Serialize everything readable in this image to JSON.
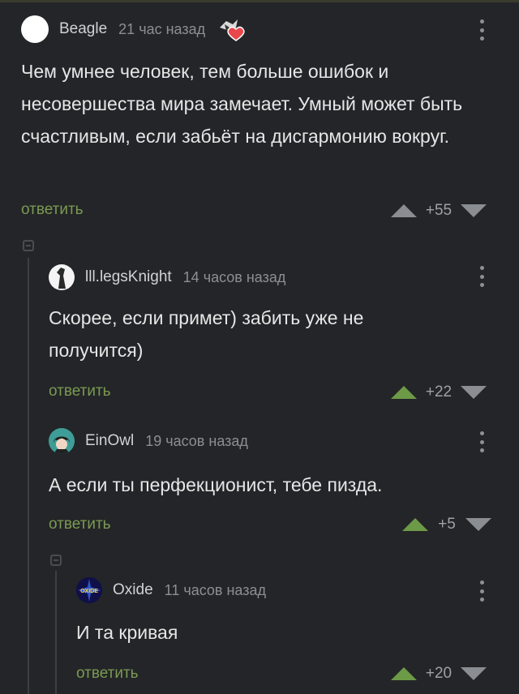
{
  "comments": [
    {
      "author": "Beagle",
      "time": "21 час назад",
      "text": "Чем умнее человек, тем больше ошибок и несовершества мира замечает. Умный может быть счастливым, если забьёт на дисгармонию вокруг.",
      "reply_label": "ответить",
      "score": "+55",
      "badge_icon": "heart-award-icon"
    },
    {
      "author": "lll.legsKnight",
      "time": "14 часов назад",
      "text": "Скорее, если примет) забить уже не получится)",
      "reply_label": "ответить",
      "score": "+22"
    },
    {
      "author": "EinOwl",
      "time": "19 часов назад",
      "text": "А если ты перфекционист, тебе пизда.",
      "reply_label": "ответить",
      "score": "+5"
    },
    {
      "author": "Oxide",
      "time": "11 часов назад",
      "text": "И та кривая",
      "reply_label": "ответить",
      "score": "+20",
      "avatar_text": "OXIDE"
    }
  ],
  "colors": {
    "background": "#242528",
    "reply": "#7a9a52",
    "upvote_active": "#6c9a47",
    "muted": "#8b8f93"
  }
}
